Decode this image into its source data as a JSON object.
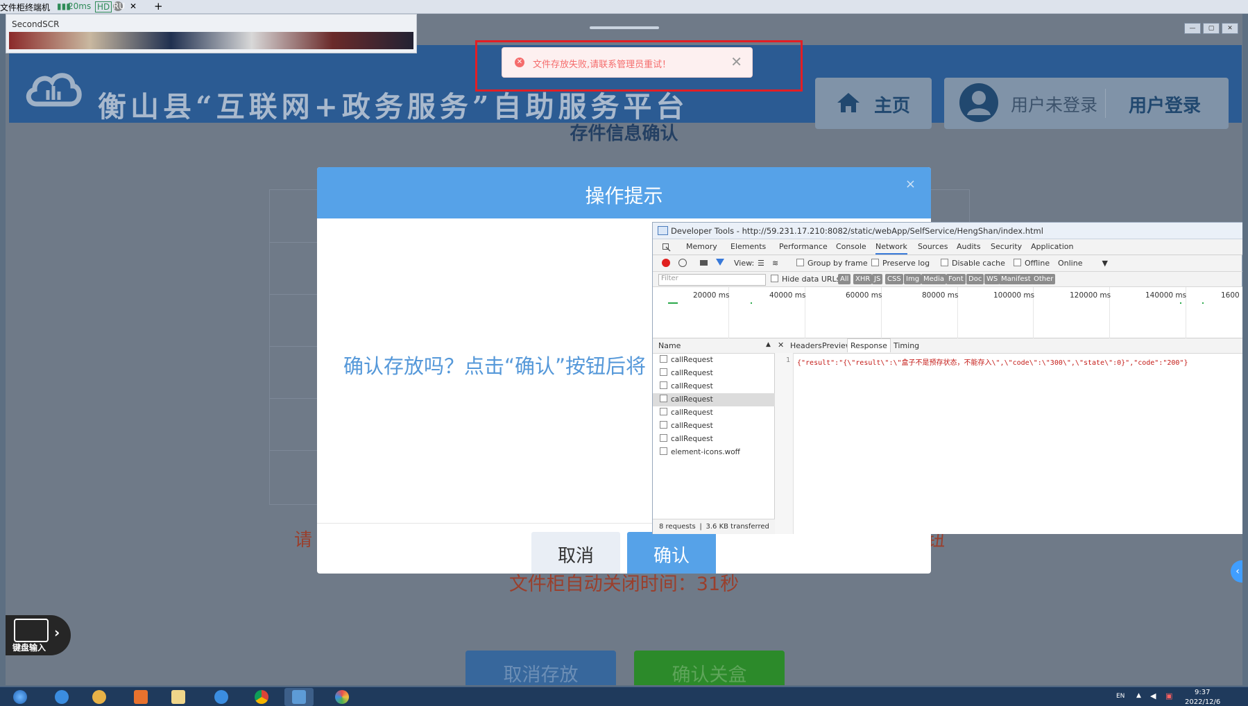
{
  "remote_tab": {
    "title": "文件柜终端机",
    "latency": "20ms",
    "hd_badge": "HD",
    "ru_badge": "RU",
    "close": "✕",
    "new_tab": "+"
  },
  "second_scr": {
    "label": "SecondSCR"
  },
  "site": {
    "title": "衡山县“互联网+政务服务”自助服务平台",
    "home_label": "主页",
    "user_status": "用户未登录",
    "login_label": "用户登录"
  },
  "toast": {
    "message": "文件存放失败,请联系管理员重试！",
    "close": "✕"
  },
  "page": {
    "section_title": "存件信息确认",
    "hint_left": "请",
    "hint_right": "钮",
    "countdown": "文件柜自动关闭时间：31秒",
    "cancel_store": "取消存放",
    "confirm_close": "确认关盒"
  },
  "keyboard": {
    "label": "键盘输入"
  },
  "modal": {
    "title": "操作提示",
    "close": "×",
    "text": "确认存放吗？点击“确认”按钮后将",
    "cancel": "取消",
    "confirm": "确认"
  },
  "devtools": {
    "title": "Developer Tools - http://59.231.17.210:8082/static/webApp/SelfService/HengShan/index.html",
    "tabs": [
      "Memory",
      "Elements",
      "Performance",
      "Console",
      "Network",
      "Sources",
      "Audits",
      "Security",
      "Application"
    ],
    "active_tab": "Network",
    "toolbar": {
      "view": "View:",
      "group_by_frame": "Group by frame",
      "preserve_log": "Preserve log",
      "disable_cache": "Disable cache",
      "offline": "Offline",
      "online": "Online"
    },
    "filter_placeholder": "Filter",
    "hide_data_urls": "Hide data URLs",
    "type_filters": [
      "All",
      "XHR",
      "JS",
      "CSS",
      "Img",
      "Media",
      "Font",
      "Doc",
      "WS",
      "Manifest",
      "Other"
    ],
    "timeline_labels": [
      "20000 ms",
      "40000 ms",
      "60000 ms",
      "80000 ms",
      "100000 ms",
      "120000 ms",
      "140000 ms",
      "1600"
    ],
    "name_header": "Name",
    "requests": [
      "callRequest",
      "callRequest",
      "callRequest",
      "callRequest",
      "callRequest",
      "callRequest",
      "callRequest",
      "element-icons.woff"
    ],
    "selected_request_index": 3,
    "summary": "8 requests ❘ 3.6 KB transferred",
    "detail_tabs": [
      "Headers",
      "Preview",
      "Response",
      "Timing"
    ],
    "active_detail_tab": "Response",
    "line_number": "1",
    "response_text": "{\"result\":\"{\\\"result\\\":\\\"盒子不是预存状态，不能存入\\\",\\\"code\\\":\\\"300\\\",\\\"state\\\":0}\",\"code\":\"200\"}"
  },
  "taskbar": {
    "lang": "EN",
    "time": "9:37",
    "date": "2022/12/6"
  },
  "colors": {
    "header_blue": "#2b5b93",
    "modal_blue": "#56a2e8",
    "error_red": "#f56c6c",
    "outline_red": "#e31e24",
    "confirm_green": "#2c8a2a"
  }
}
